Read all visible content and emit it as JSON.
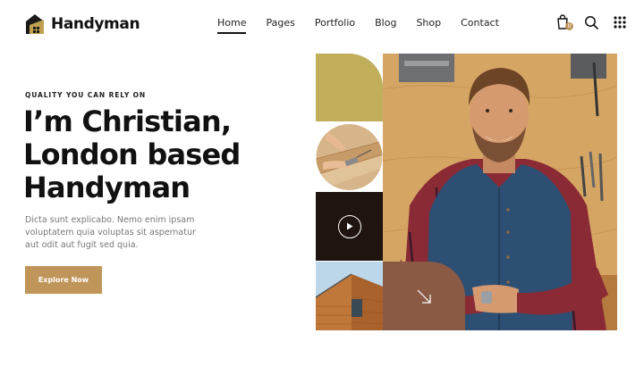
{
  "header": {
    "logo_text": "Handyman",
    "nav": [
      {
        "label": "Home",
        "active": true
      },
      {
        "label": "Pages",
        "active": false
      },
      {
        "label": "Portfolio",
        "active": false
      },
      {
        "label": "Blog",
        "active": false
      },
      {
        "label": "Shop",
        "active": false
      },
      {
        "label": "Contact",
        "active": false
      }
    ],
    "cart_count": "0",
    "icons": [
      "cart-icon",
      "search-icon",
      "grid-menu-icon"
    ]
  },
  "hero": {
    "eyebrow": "QUALITY YOU CAN RELY ON",
    "title_lines": [
      "I’m Christian,",
      "London based",
      "Handyman"
    ],
    "description": "Dicta sunt explicabo. Nemo enim ipsam voluptatem quia voluptas sit aspernatur aut odit aut fugit sed quia.",
    "button_label": "Explore Now"
  },
  "colors": {
    "accent": "#c0955a",
    "olive": "#c0ae5b",
    "dark": "#1f1410",
    "brown": "#8b5a45"
  }
}
